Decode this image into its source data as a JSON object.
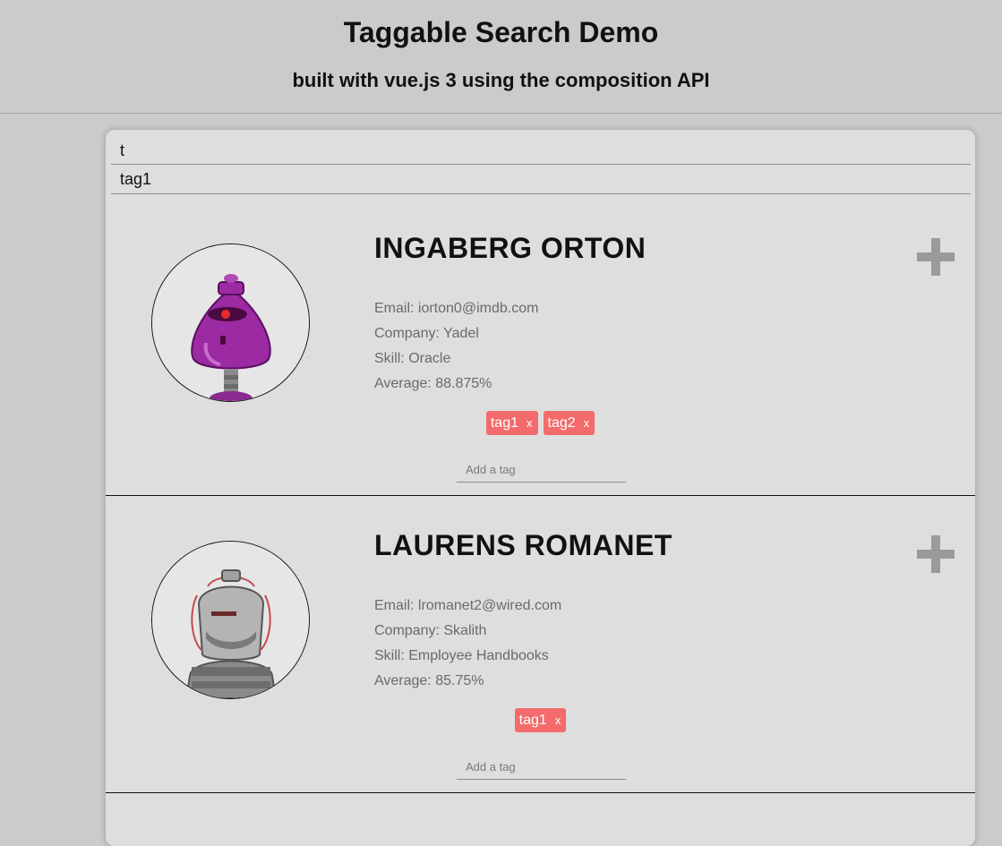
{
  "header": {
    "title": "Taggable Search Demo",
    "subtitle": "built with vue.js 3 using the composition API"
  },
  "search": {
    "name_value": "t",
    "tag_value": "tag1"
  },
  "students": [
    {
      "name": "INGABERG ORTON",
      "email": "Email: iorton0@imdb.com",
      "company": "Company: Yadel",
      "skill": "Skill: Oracle",
      "average": "Average: 88.875%",
      "tags": [
        "tag1",
        "tag2"
      ],
      "avatar_icon": "purple-robot-avatar",
      "add_tag_placeholder": "Add a tag"
    },
    {
      "name": "LAURENS ROMANET",
      "email": "Email: lromanet2@wired.com",
      "company": "Company: Skalith",
      "skill": "Skill: Employee Handbooks",
      "average": "Average: 85.75%",
      "tags": [
        "tag1"
      ],
      "avatar_icon": "gray-robot-avatar",
      "add_tag_placeholder": "Add a tag"
    }
  ],
  "tag_remove_label": "x",
  "colors": {
    "background": "#cbcbcb",
    "card": "#dedede",
    "tag": "#f36b6b",
    "expand_icon": "#9a9a9a"
  }
}
